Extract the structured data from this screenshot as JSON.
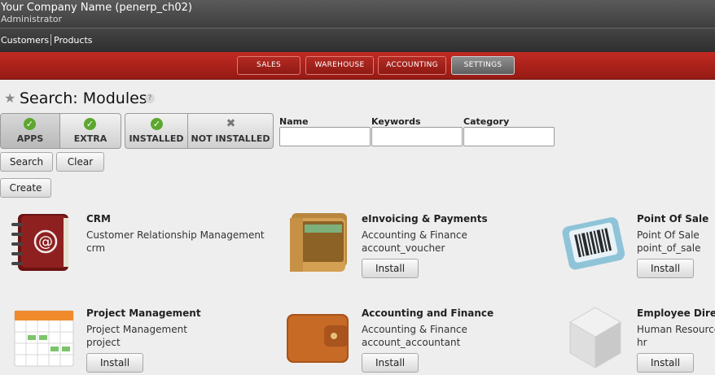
{
  "header": {
    "company": "Your Company Name (penerp_ch02)",
    "role": "Administrator"
  },
  "menu": {
    "items": [
      "Customers",
      "Products"
    ]
  },
  "main_tabs": [
    {
      "label": "SALES",
      "active": false
    },
    {
      "label": "WAREHOUSE",
      "active": false
    },
    {
      "label": "ACCOUNTING",
      "active": false
    },
    {
      "label": "SETTINGS",
      "active": true
    }
  ],
  "page": {
    "title": "Search: Modules",
    "help": "?"
  },
  "filters": {
    "group1": [
      {
        "label": "APPS",
        "icon": "check-icon",
        "active": true
      },
      {
        "label": "EXTRA",
        "icon": "check-icon",
        "active": false
      }
    ],
    "group2": [
      {
        "label": "INSTALLED",
        "icon": "check-icon",
        "active": false
      },
      {
        "label": "NOT INSTALLED",
        "icon": "cross-icon",
        "active": false
      }
    ],
    "fields": [
      {
        "label": "Name",
        "value": ""
      },
      {
        "label": "Keywords",
        "value": ""
      },
      {
        "label": "Category",
        "value": ""
      }
    ]
  },
  "actions": {
    "search": "Search",
    "clear": "Clear",
    "create": "Create"
  },
  "modules": [
    {
      "name": "CRM",
      "category": "Customer Relationship Management",
      "technical": "crm",
      "button": "",
      "icon": "address-book-icon"
    },
    {
      "name": "eInvoicing & Payments",
      "category": "Accounting & Finance",
      "technical": "account_voucher",
      "button": "Install",
      "icon": "wallet-icon"
    },
    {
      "name": "Point Of Sale",
      "category": "Point Of Sale",
      "technical": "point_of_sale",
      "button": "Install",
      "icon": "barcode-icon"
    },
    {
      "name": "Project Management",
      "category": "Project Management",
      "technical": "project",
      "button": "Install",
      "icon": "calendar-icon"
    },
    {
      "name": "Accounting and Finance",
      "category": "Accounting & Finance",
      "technical": "account_accountant",
      "button": "Install",
      "icon": "leather-wallet-icon"
    },
    {
      "name": "Employee Direc",
      "category": "Human Resource",
      "technical": "hr",
      "button": "Install",
      "icon": "cube-icon"
    }
  ]
}
